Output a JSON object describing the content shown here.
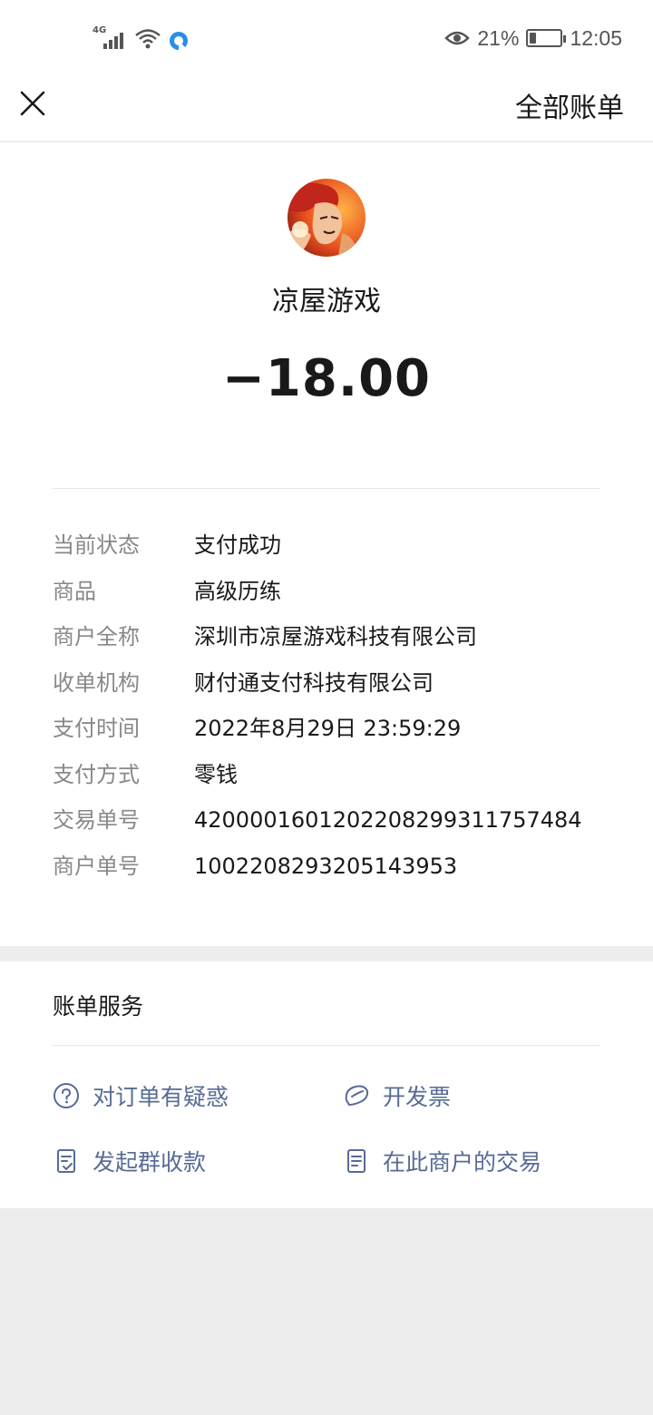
{
  "status_bar": {
    "network": "4G",
    "battery": "21%",
    "battery_level": 0.21,
    "time": "12:05",
    "icons": [
      "signal-icon",
      "wifi-icon",
      "app-notification-icon",
      "eye-comfort-icon",
      "battery-icon"
    ]
  },
  "nav": {
    "close_icon": "close-icon",
    "all_bills": "全部账单"
  },
  "merchant": {
    "name": "凉屋游戏",
    "amount": "−18.00"
  },
  "details": [
    {
      "label": "当前状态",
      "value": "支付成功"
    },
    {
      "label": "商品",
      "value": "高级历练"
    },
    {
      "label": "商户全称",
      "value": "深圳市凉屋游戏科技有限公司"
    },
    {
      "label": "收单机构",
      "value": "财付通支付科技有限公司"
    },
    {
      "label": "支付时间",
      "value": "2022年8月29日 23:59:29"
    },
    {
      "label": "支付方式",
      "value": "零钱"
    },
    {
      "label": "交易单号",
      "value": "4200001601202208299311757484"
    },
    {
      "label": "商户单号",
      "value": "1002208293205143953"
    }
  ],
  "services": {
    "title": "账单服务",
    "items": [
      {
        "label": "对订单有疑惑",
        "icon": "question-icon"
      },
      {
        "label": "开发票",
        "icon": "invoice-icon"
      },
      {
        "label": "发起群收款",
        "icon": "group-collect-icon"
      },
      {
        "label": "在此商户的交易",
        "icon": "document-icon"
      }
    ]
  },
  "colors": {
    "link": "#576b95",
    "label_gray": "#888888",
    "text": "#191919",
    "background": "#ededed"
  }
}
